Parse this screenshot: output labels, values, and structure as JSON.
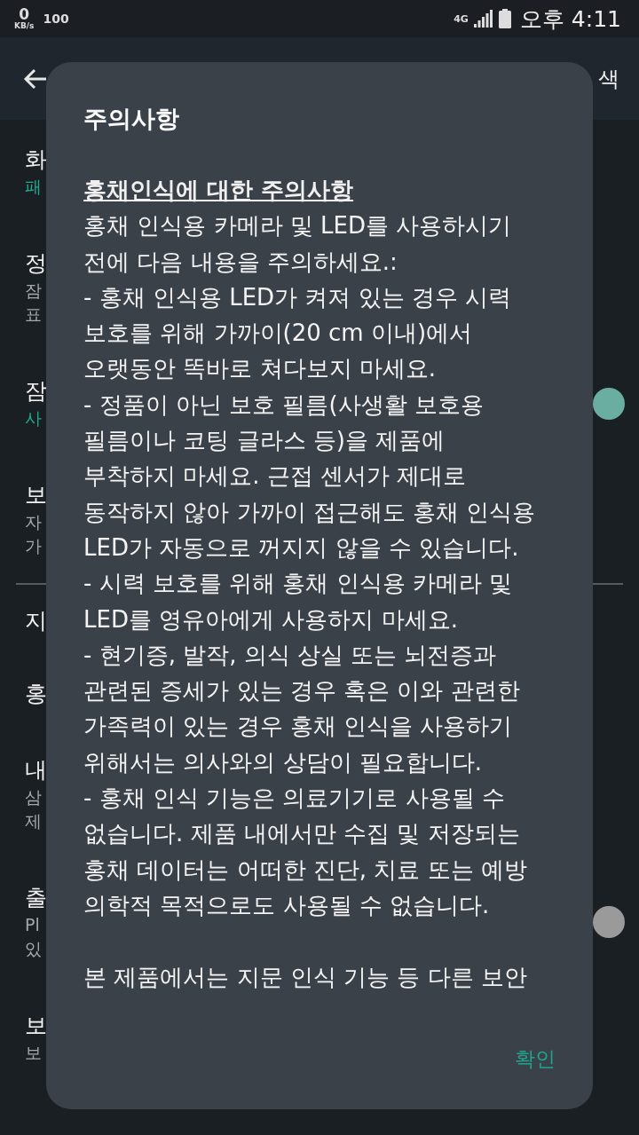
{
  "status_bar": {
    "speed": "0",
    "speed_unit": "KB/s",
    "level_text": "100",
    "network": "4G",
    "time": "오후 4:11"
  },
  "header": {
    "action": "색"
  },
  "settings": [
    {
      "title": "화",
      "subtitle": [
        "패"
      ],
      "accent": true
    },
    {
      "title": "정",
      "subtitle": [
        "잠",
        "표"
      ],
      "accent": false
    },
    {
      "title": "잠",
      "subtitle": [
        "사"
      ],
      "accent": true,
      "switch_on": true
    },
    {
      "title": "보",
      "subtitle": [
        "자",
        "가"
      ],
      "accent": false,
      "divider_after": true
    },
    {
      "title": "지"
    },
    {
      "title": "홍"
    },
    {
      "title": "내",
      "subtitle": [
        "삼",
        "제"
      ],
      "accent": false
    },
    {
      "title": "출",
      "subtitle": [
        "Pl",
        "있"
      ],
      "accent": false,
      "switch_on": false
    },
    {
      "title": "보",
      "subtitle": [
        "보"
      ],
      "accent": false
    }
  ],
  "dialog": {
    "title": "주의사항",
    "heading": "홍채인식에 대한 주의사항",
    "paragraphs": [
      [
        "홍채 인식용 카메라 및 LED를 사용하시기",
        "전에 다음 내용을 주의하세요.:"
      ],
      [
        "- 홍채 인식용 LED가 켜져 있는 경우 시력",
        "보호를 위해 가까이(20 cm 이내)에서",
        "오랫동안 똑바로 쳐다보지 마세요."
      ],
      [
        "- 정품이 아닌 보호 필름(사생활 보호용",
        "필름이나 코팅 글라스 등)을 제품에",
        "부착하지 마세요. 근접 센서가 제대로",
        "동작하지 않아 가까이 접근해도 홍채 인식용",
        "LED가 자동으로 꺼지지 않을 수 있습니다."
      ],
      [
        "- 시력 보호를 위해 홍채 인식용 카메라 및",
        "LED를 영유아에게 사용하지 마세요."
      ],
      [
        "- 현기증, 발작, 의식 상실 또는 뇌전증과",
        "관련된 증세가 있는 경우 혹은 이와 관련한",
        "가족력이 있는 경우 홍채 인식을 사용하기",
        "위해서는 의사와의 상담이 필요합니다."
      ],
      [
        "- 홍채 인식 기능은 의료기기로 사용될 수",
        "없습니다. 제품 내에서만 수집 및 저장되는",
        "홍채 데이터는 어떠한 진단, 치료 또는 예방",
        "의학적 목적으로도 사용될 수 없습니다."
      ]
    ],
    "footer_paragraph": [
      "본 제품에서는 지문 인식 기능 등 다른 보안"
    ],
    "button": "확인"
  }
}
